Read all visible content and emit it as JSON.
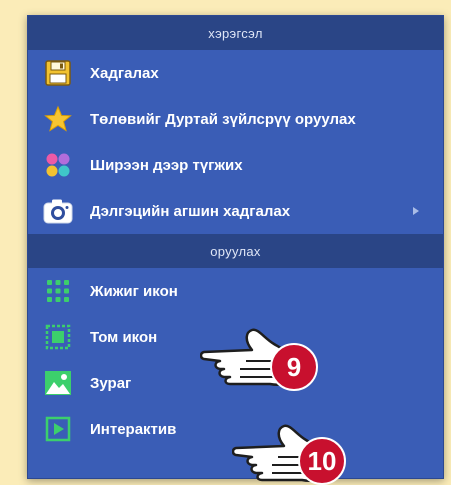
{
  "sections": [
    {
      "header": "хэрэгсэл",
      "items": [
        {
          "label": "Хадгалах",
          "icon": "save-icon"
        },
        {
          "label": "Төлөвийг Дуртай зүйлсрүү оруулах",
          "icon": "star-icon"
        },
        {
          "label": "Ширээн дээр түгжих",
          "icon": "palette-dots-icon"
        },
        {
          "label": "Дэлгэцийн агшин хадгалах",
          "icon": "camera-icon",
          "submenu": true
        }
      ]
    },
    {
      "header": "оруулах",
      "items": [
        {
          "label": "Жижиг икон",
          "icon": "small-icons-grid-icon"
        },
        {
          "label": "Том икон",
          "icon": "large-icon-icon"
        },
        {
          "label": "Зураг",
          "icon": "image-icon"
        },
        {
          "label": "Интерактив",
          "icon": "play-icon"
        }
      ]
    }
  ],
  "callouts": [
    {
      "number": "9",
      "target": "Том икон"
    },
    {
      "number": "10",
      "target": "Интерактив"
    }
  ],
  "colors": {
    "page_bg": "#fbecb8",
    "menu_bg": "#3a5db6",
    "header_bg": "#2a4586",
    "badge": "#c8102e"
  }
}
